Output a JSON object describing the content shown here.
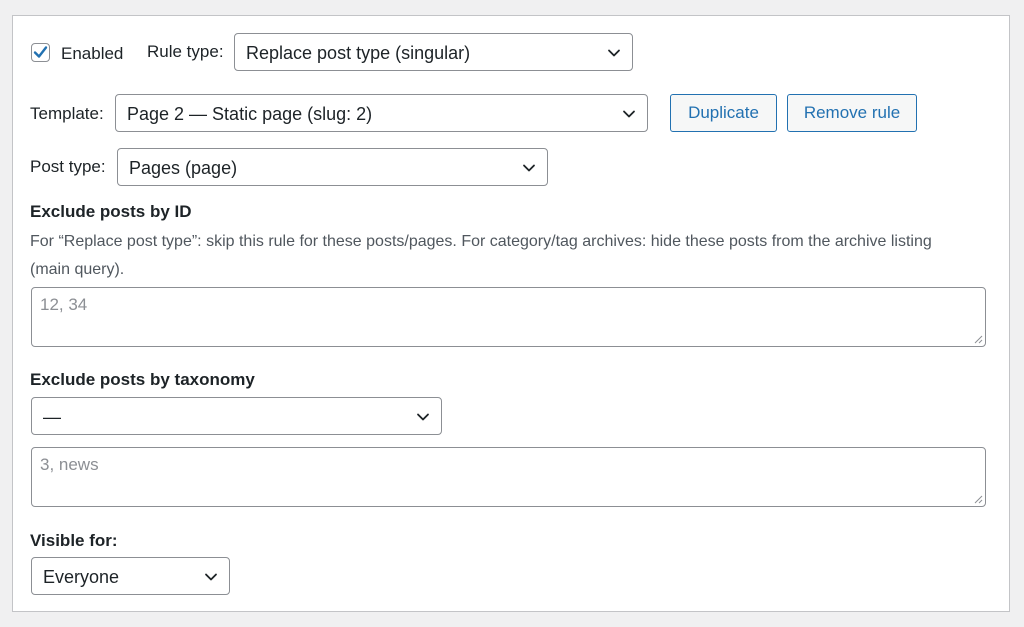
{
  "rule": {
    "enabled": true,
    "enabled_label": "Enabled",
    "rule_type_label": "Rule type:",
    "rule_type_value": "Replace post type (singular)",
    "template_label": "Template:",
    "template_value": "Page 2 — Static page (slug: 2)",
    "duplicate_label": "Duplicate",
    "remove_label": "Remove rule",
    "post_type_label": "Post type:",
    "post_type_value": "Pages (page)"
  },
  "exclude_id": {
    "heading": "Exclude posts by ID",
    "description": "For “Replace post type”: skip this rule for these posts/pages. For category/tag archives: hide these posts from the archive listing (main query).",
    "placeholder": "12, 34"
  },
  "exclude_taxonomy": {
    "heading": "Exclude posts by taxonomy",
    "taxonomy_value": "—",
    "placeholder": "3, news"
  },
  "visibility": {
    "heading": "Visible for:",
    "value": "Everyone"
  },
  "icons": {
    "check": "checkmark-icon",
    "dropdown": "chevron-down-icon",
    "resize": "resize-grip-icon"
  },
  "colors": {
    "accent": "#2271b1",
    "border": "#8c8f94",
    "background": "#f0f0f1"
  }
}
